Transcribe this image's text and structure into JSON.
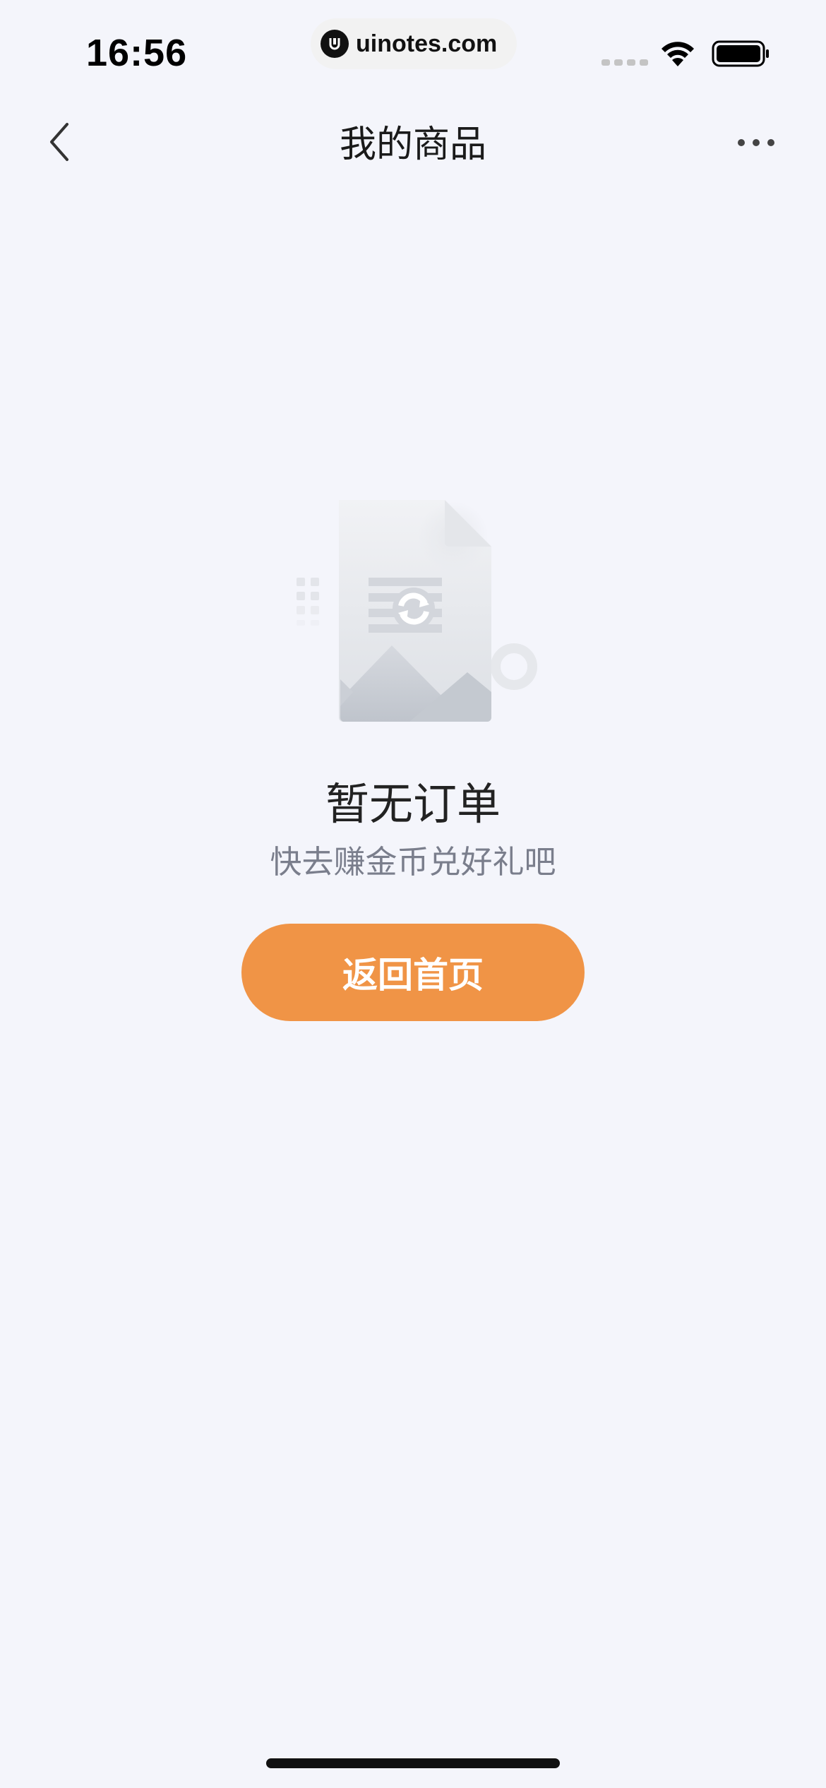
{
  "status_bar": {
    "time": "16:56",
    "url": "uinotes.com"
  },
  "nav": {
    "title": "我的商品",
    "back_icon": "chevron-left-icon",
    "more_icon": "more-dots-icon"
  },
  "empty_state": {
    "title": "暂无订单",
    "subtitle": "快去赚金币兑好礼吧",
    "button_label": "返回首页",
    "illustration_icon": "empty-document-icon"
  },
  "colors": {
    "background": "#F4F5FB",
    "accent": "#F09446",
    "title_text": "#222222",
    "subtitle_text": "#7A7E8C"
  }
}
